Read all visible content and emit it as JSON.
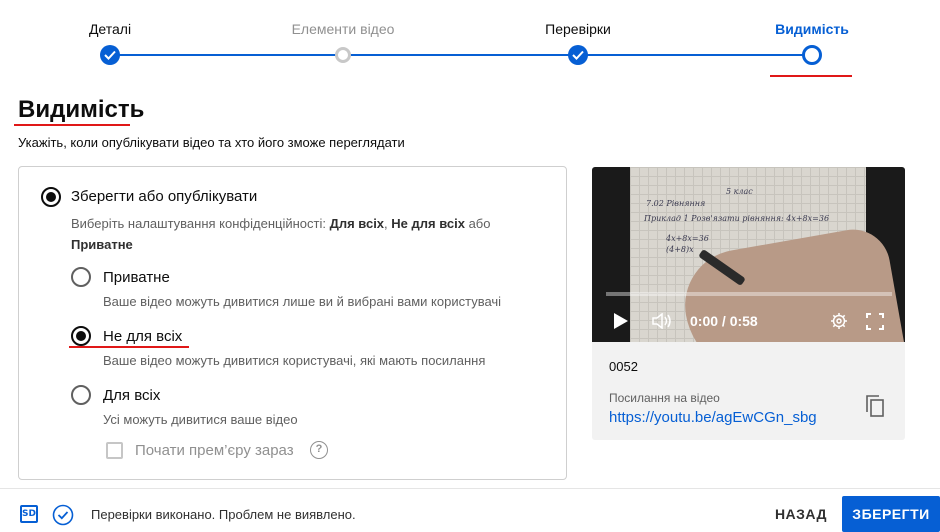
{
  "stepper": {
    "steps": [
      {
        "label": "Деталі",
        "state": "done"
      },
      {
        "label": "Елементи відео",
        "state": "incomplete"
      },
      {
        "label": "Перевірки",
        "state": "done"
      },
      {
        "label": "Видимість",
        "state": "active"
      }
    ]
  },
  "page": {
    "title": "Видимість",
    "subtitle": "Укажіть, коли опублікувати відео та хто його зможе переглядати"
  },
  "options": {
    "save_or_publish": {
      "label": "Зберегти або опублікувати",
      "desc_prefix": "Виберіть налаштування конфіденційності: ",
      "desc_public": "Для всіх",
      "desc_sep": ", ",
      "desc_unlisted": "Не для всіх",
      "desc_or": " або",
      "desc_private": "Приватне",
      "checked": true
    },
    "private": {
      "label": "Приватне",
      "desc": "Ваше відео можуть дивитися лише ви й вибрані вами користувачі",
      "checked": false
    },
    "unlisted": {
      "label": "Не для всіх",
      "desc": "Ваше відео можуть дивитися користувачі, які мають посилання",
      "checked": true
    },
    "public": {
      "label": "Для всіх",
      "desc": "Усі можуть дивитися ваше відео",
      "checked": false
    },
    "premiere": {
      "label": "Почати прем’єру зараз",
      "checked": false,
      "help_symbol": "?"
    }
  },
  "video": {
    "time": "0:00 / 0:58",
    "name": "0052",
    "link_label": "Посилання на відео",
    "link": "https://youtu.be/agEwCGn_sbg",
    "progress": 0
  },
  "footer": {
    "sd_badge": "SD",
    "status": "Перевірки виконано. Проблем не виявлено.",
    "back_label": "НАЗАД",
    "save_label": "ЗБЕРЕГТИ"
  },
  "colors": {
    "accent": "#065fd4",
    "annotation_red": "#e01818"
  }
}
